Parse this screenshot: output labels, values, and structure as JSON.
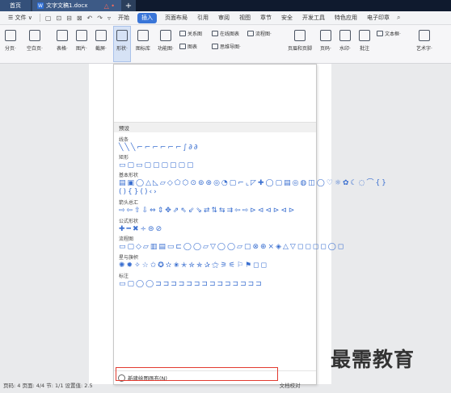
{
  "titlebar": {
    "home_tab": "首页",
    "doc_tab": "文字文稿1.docx",
    "doc_icon": "W",
    "close_glyph": "△ •",
    "new_tab": "+"
  },
  "menubar": {
    "file": "☰ 文件 ∨",
    "items": [
      "开始",
      "插入",
      "页面布局",
      "引用",
      "审阅",
      "视图",
      "章节",
      "安全",
      "开发工具",
      "特色应用",
      "电子印章"
    ],
    "active": "插入"
  },
  "ribbon": {
    "cover": "分页·",
    "blank": "空白页·",
    "table": "表格·",
    "image": "图片·",
    "screenshot": "截屏·",
    "shape": "形状·",
    "icon_lib": "图标库",
    "func_chart": "功能图·",
    "chart": "图表",
    "relation": "关系图",
    "online_chart": "在线图表",
    "flowchart": "流程图·",
    "mindmap": "思维导图·",
    "header_footer": "页眉和页脚",
    "page_num": "页码·",
    "watermark": "水印·",
    "comment": "批注",
    "textbox": "文本框·",
    "wordart": "艺术字·"
  },
  "dropdown": {
    "header": "预设",
    "categories": [
      {
        "name": "线条",
        "shapes": "╲╲╲⌐⌐⌐⌐⌐⌐∫∂∂"
      },
      {
        "name": "矩形",
        "shapes": "▭▢▭▢▢▢▢▢▢"
      },
      {
        "name": "基本形状",
        "shapes": "▤▣◯△◺▱◇⬠⬡⊙⊚⊛◎◔▢⌐⌞◸✚◯▢▤◎◍◫◯♡☼✿☾◌⌒{}(){}()‹›"
      },
      {
        "name": "箭头总汇",
        "shapes": "⇨⇦⇧⇩⇔⇕✥⇗⇖⇙⇘⇄⇅⇆⇉⇦⇨⊳⊲⊲⊳⊲⊳"
      },
      {
        "name": "公式形状",
        "shapes": "✚━✖÷⊜⊘"
      },
      {
        "name": "流程图",
        "shapes": "▭▢◇▱▥▤▭⊏◯◯▱▽◯◯▱▢⊗⊕⨯◈△▽◻◻◻◻◯◻"
      },
      {
        "name": "星与旗帜",
        "shapes": "✺✹✧☆✩✪✫✬✭✮✯✰⚝⚞⚟⚐⚑◻◻"
      },
      {
        "name": "标注",
        "shapes": "▭▢◯◯⊐⊐⊐⊐⊐⊐⊐⊐⊐⊐⊐⊐⊐⊐"
      }
    ],
    "footer": "新建绘图画布(N)"
  },
  "statusbar": {
    "text": "页码: 4  页面: 4/4  节: 1/1  设置值: 2.5",
    "right": "文档校对"
  },
  "watermark": "最需教育"
}
